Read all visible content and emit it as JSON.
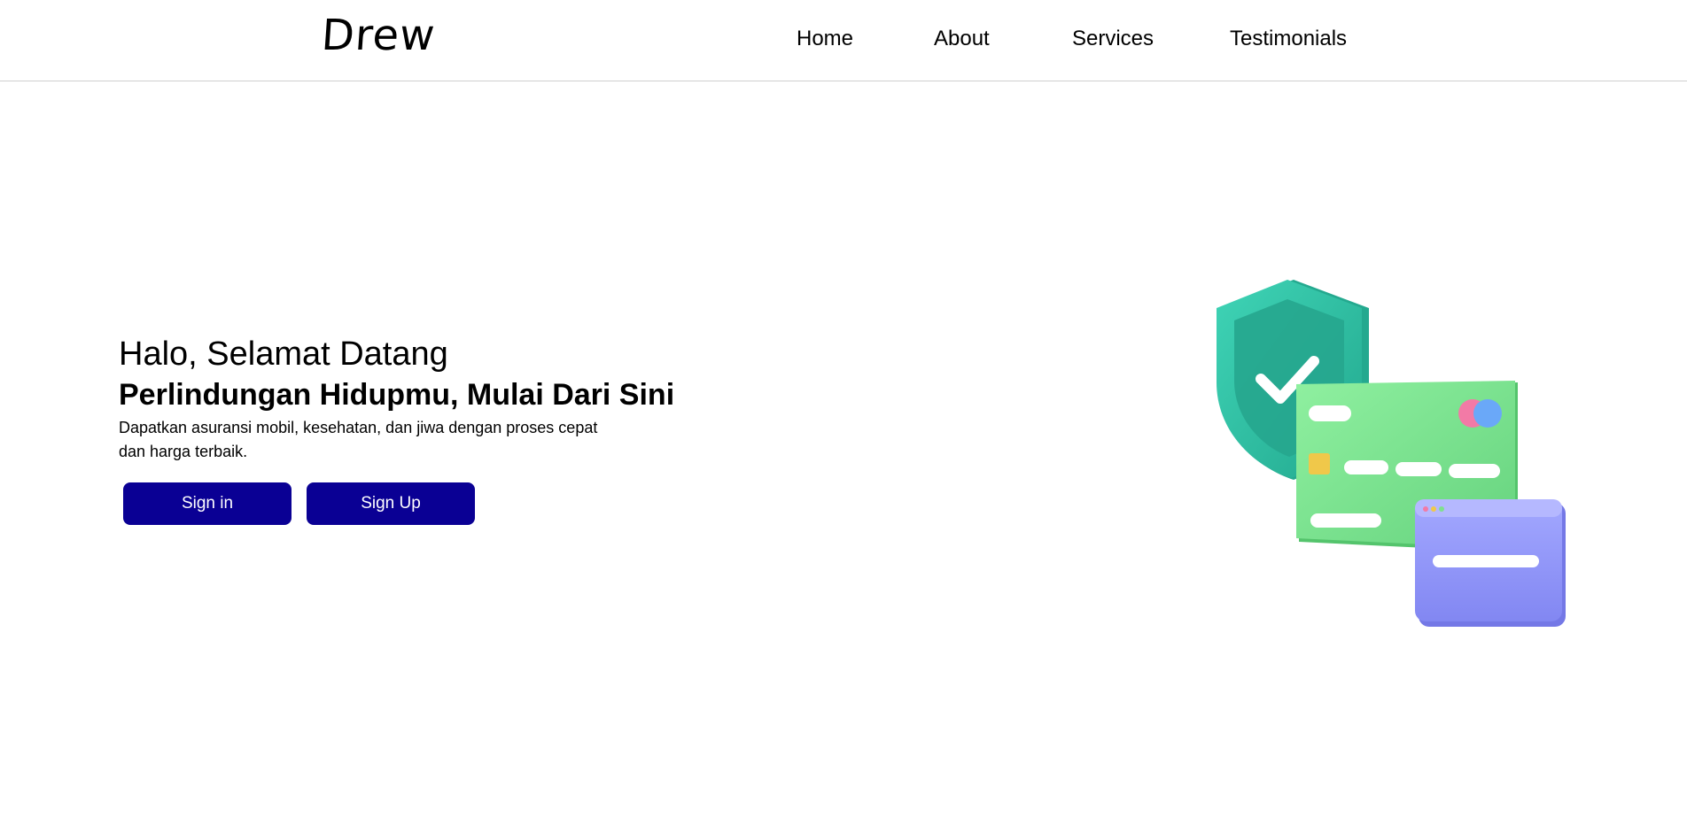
{
  "brand": {
    "name": "Drew"
  },
  "nav": {
    "items": [
      {
        "label": "Home"
      },
      {
        "label": "About"
      },
      {
        "label": "Services"
      },
      {
        "label": "Testimonials"
      }
    ]
  },
  "hero": {
    "greeting": "Halo, Selamat Datang",
    "title": "Perlindungan Hidupmu, Mulai Dari Sini",
    "description": "Dapatkan asuransi mobil, kesehatan, dan jiwa dengan proses cepat dan harga terbaik.",
    "buttons": {
      "sign_in": "Sign in",
      "sign_up": "Sign Up"
    }
  },
  "colors": {
    "button_bg": "#0a0094",
    "shield": "#2ec4a6",
    "card": "#7ee08f",
    "browser_window": "#8e93f5"
  },
  "icons": {
    "illustration": "insurance-shield-card-illustration"
  }
}
